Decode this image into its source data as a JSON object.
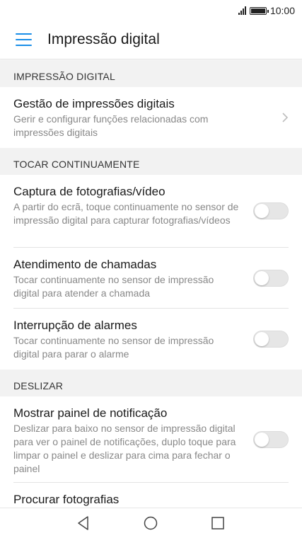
{
  "status_bar": {
    "time": "10:00",
    "signal_icon": "signal-icon",
    "battery_icon": "battery-icon"
  },
  "app_bar": {
    "title": "Impressão digital",
    "menu_icon": "menu-icon",
    "accent_color": "#1a8ee8"
  },
  "sections": [
    {
      "header": "IMPRESSÃO DIGITAL",
      "items": [
        {
          "title": "Gestão de impressões digitais",
          "subtitle": "Gerir e configurar funções relacionadas com impressões digitais",
          "control": "chevron"
        }
      ]
    },
    {
      "header": "TOCAR CONTINUAMENTE",
      "items": [
        {
          "title": "Captura de fotografias/vídeo",
          "subtitle": "A partir do ecrã, toque continuamente no sensor de impressão digital para capturar fotografias/vídeos",
          "control": "toggle",
          "enabled": false
        },
        {
          "title": "Atendimento de chamadas",
          "subtitle": "Tocar continuamente no sensor de impressão digital para atender a chamada",
          "control": "toggle",
          "enabled": false
        },
        {
          "title": "Interrupção de alarmes",
          "subtitle": "Tocar continuamente no sensor de impressão digital para parar o alarme",
          "control": "toggle",
          "enabled": false
        }
      ]
    },
    {
      "header": "DESLIZAR",
      "items": [
        {
          "title": "Mostrar painel de notificação",
          "subtitle": "Deslizar para baixo no sensor de impressão digital para ver o painel de notificações, duplo toque para limpar o painel e deslizar para cima para fechar o painel",
          "control": "toggle",
          "enabled": false
        },
        {
          "title": "Procurar fotografias",
          "subtitle": "",
          "control": "none"
        }
      ]
    }
  ],
  "nav_bar": {
    "back_icon": "back-icon",
    "home_icon": "home-icon",
    "recents_icon": "recents-icon"
  }
}
